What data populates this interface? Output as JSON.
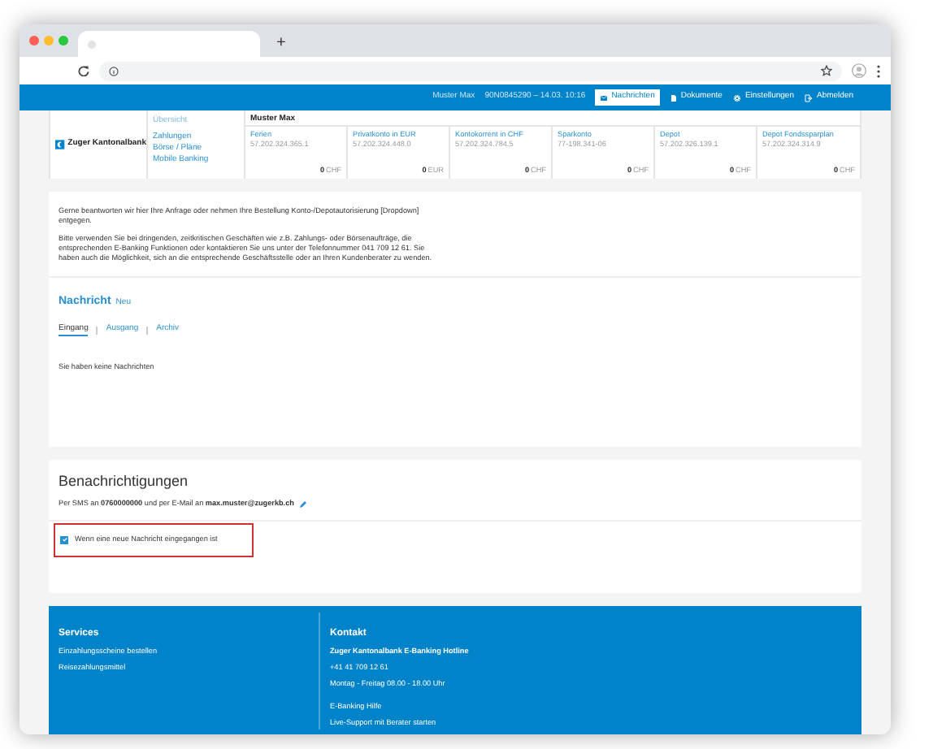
{
  "browser": {
    "new_tab": "+"
  },
  "topbar": {
    "user": "Muster Max",
    "session": "90N0845290 – 14.03. 10:16",
    "actions": [
      {
        "label": "Nachrichten",
        "kind": "mail",
        "selected": true
      },
      {
        "label": "Dokumente",
        "kind": "doc",
        "selected": false
      },
      {
        "label": "Einstellungen",
        "kind": "gear",
        "selected": false
      },
      {
        "label": "Abmelden",
        "kind": "logout",
        "selected": false
      }
    ]
  },
  "nav": {
    "logo": "Zuger Kantonalbank",
    "links": [
      {
        "label": "Übersicht",
        "selected": true
      },
      {
        "label": "Zahlungen",
        "selected": false
      },
      {
        "label": "Börse / Pläne",
        "selected": false
      },
      {
        "label": "Mobile Banking",
        "selected": false
      }
    ],
    "owner": "Muster Max",
    "accounts": [
      {
        "name": "Ferien",
        "number": "57.202.324.365.1",
        "amount": "0",
        "currency": "CHF"
      },
      {
        "name": "Privatkonto in EUR",
        "number": "57.202.324.448.0",
        "amount": "0",
        "currency": "EUR"
      },
      {
        "name": "Kontokorrent in CHF",
        "number": "57.202.324.784.5",
        "amount": "0",
        "currency": "CHF"
      },
      {
        "name": "Sparkonto",
        "number": "77-198.341-06",
        "amount": "0",
        "currency": "CHF"
      },
      {
        "name": "Depot",
        "number": "57.202.326.139.1",
        "amount": "0",
        "currency": "CHF"
      },
      {
        "name": "Depot Fondssparplan",
        "number": "57.202.324.314.9",
        "amount": "0",
        "currency": "CHF"
      }
    ]
  },
  "messages": {
    "paragraphs": [
      "Gerne beantworten wir hier Ihre Anfrage oder nehmen Ihre Bestellung Konto-/Depotautorisierung [Dropdown] entgegen.",
      "Bitte verwenden Sie bei dringenden, zeitkritischen Geschäften wie z.B. Zahlungs- oder Börsenaufträge, die entsprechenden E-Banking Funktionen oder kontaktieren Sie uns unter der Telefonnummer 041 709 12 61. Sie haben auch die Möglichkeit, sich an die entsprechende Geschäftsstelle oder an Ihren Kundenberater zu wenden."
    ],
    "heading": "Nachricht",
    "new_link": "Neu",
    "tabs": [
      {
        "label": "Eingang",
        "selected": true
      },
      {
        "label": "Ausgang",
        "selected": false
      },
      {
        "label": "Archiv",
        "selected": false
      }
    ],
    "empty": "Sie haben keine Nachrichten"
  },
  "notifications": {
    "title": "Benachrichtigungen",
    "info": "Per SMS an **0760000000** und per E-Mail an **max.muster@zugerkb.ch**",
    "options": [
      {
        "label": "Wenn eine neue Nachricht eingegangen ist",
        "checked": true,
        "highlighted": true
      }
    ]
  },
  "footer": {
    "services": {
      "title": "Services",
      "links": [
        "Einzahlungsscheine bestellen",
        "Reisezahlungsmittel"
      ]
    },
    "contact": {
      "title": "Kontakt",
      "lines": [
        {
          "kind": "heading",
          "text": "Zuger Kantonalbank E-Banking Hotline"
        },
        {
          "kind": "text",
          "text": "+41 41 709 12 61"
        },
        {
          "kind": "text",
          "text": "Montag - Freitag 08.00 - 18.00 Uhr"
        },
        {
          "kind": "gap_link",
          "text": "E-Banking Hilfe"
        },
        {
          "kind": "link",
          "text": "Live-Support mit Berater starten"
        }
      ]
    }
  }
}
